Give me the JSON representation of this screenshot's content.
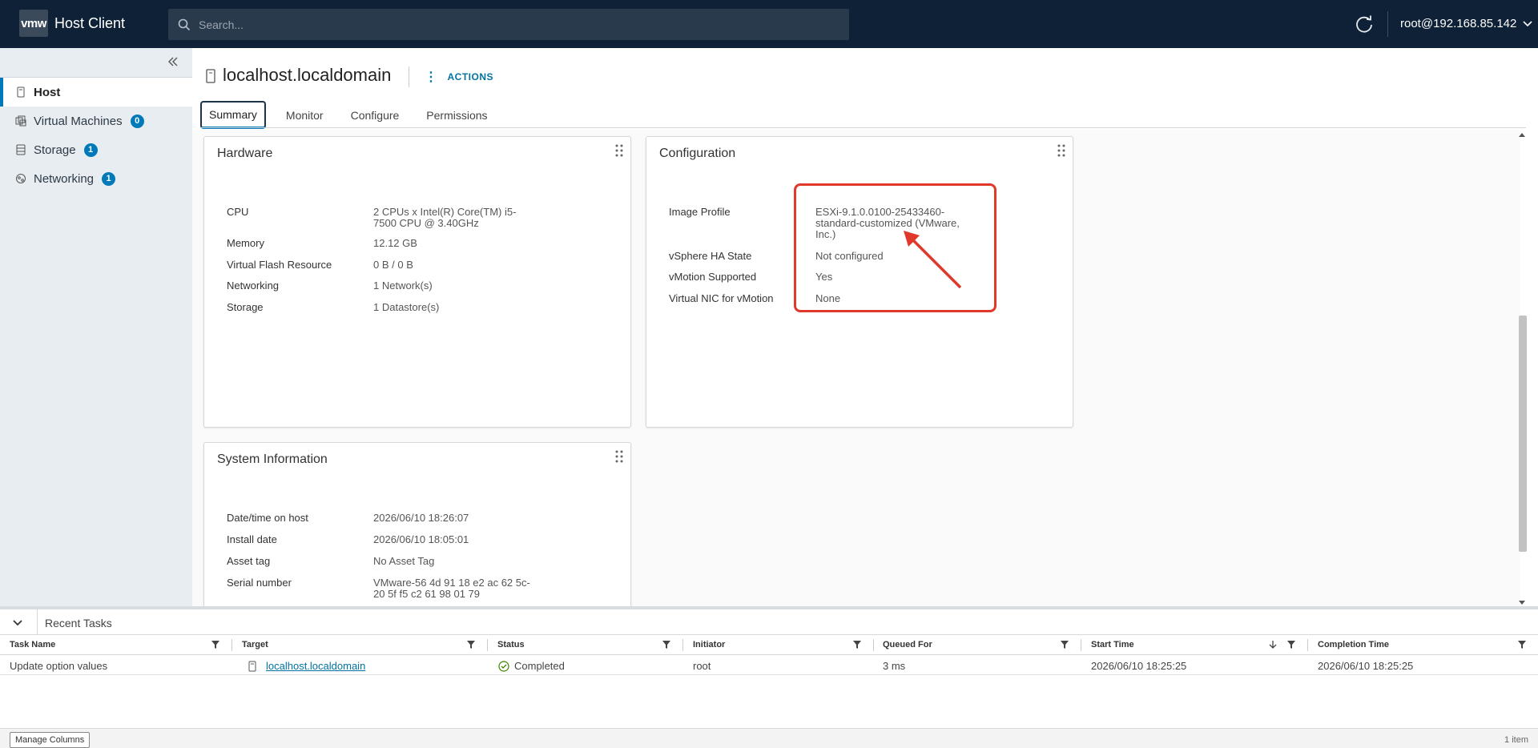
{
  "header": {
    "logo_text": "vmw",
    "app_title": "Host Client",
    "search_placeholder": "Search...",
    "user": "root@192.168.85.142"
  },
  "sidebar": {
    "items": [
      {
        "label": "Host",
        "icon": "host-icon",
        "badge": ""
      },
      {
        "label": "Virtual Machines",
        "icon": "vm-icon",
        "badge": "0"
      },
      {
        "label": "Storage",
        "icon": "storage-icon",
        "badge": "1"
      },
      {
        "label": "Networking",
        "icon": "network-icon",
        "badge": "1"
      }
    ]
  },
  "main": {
    "title": "localhost.localdomain",
    "actions_label": "ACTIONS",
    "tabs": [
      "Summary",
      "Monitor",
      "Configure",
      "Permissions"
    ],
    "active_tab": "Summary"
  },
  "hardware": {
    "title": "Hardware",
    "rows": [
      {
        "k": "CPU",
        "v": "2 CPUs x Intel(R) Core(TM) i5-7500 CPU @ 3.40GHz"
      },
      {
        "k": "Memory",
        "v": "12.12 GB"
      },
      {
        "k": "Virtual Flash Resource",
        "v": "0 B / 0 B"
      },
      {
        "k": "Networking",
        "v": "1 Network(s)"
      },
      {
        "k": "Storage",
        "v": "1 Datastore(s)"
      }
    ]
  },
  "configuration": {
    "title": "Configuration",
    "rows": [
      {
        "k": "Image Profile",
        "v": "ESXi-9.1.0.0100-25433460-standard-customized (VMware, Inc.)"
      },
      {
        "k": "vSphere HA State",
        "v": "Not configured"
      },
      {
        "k": "vMotion Supported",
        "v": "Yes"
      },
      {
        "k": "Virtual NIC for vMotion",
        "v": "None"
      }
    ]
  },
  "system_info": {
    "title": "System Information",
    "rows": [
      {
        "k": "Date/time on host",
        "v": "2026/06/10 18:26:07"
      },
      {
        "k": "Install date",
        "v": "2026/06/10 18:05:01"
      },
      {
        "k": "Asset tag",
        "v": "No Asset Tag"
      },
      {
        "k": "Serial number",
        "v": "VMware-56 4d 91 18 e2 ac 62 5c-20 5f f5 c2 61 98 01 79"
      }
    ]
  },
  "recent_tasks": {
    "title": "Recent Tasks",
    "columns": [
      "Task Name",
      "Target",
      "Status",
      "Initiator",
      "Queued For",
      "Start Time",
      "Completion Time"
    ],
    "rows": [
      {
        "task_name": "Update option values",
        "target": "localhost.localdomain",
        "status": "Completed",
        "initiator": "root",
        "queued_for": "3 ms",
        "start_time": "2026/06/10 18:25:25",
        "completion_time": "2026/06/10 18:25:25"
      }
    ],
    "manage_columns": "Manage Columns",
    "item_count": "1 item"
  },
  "colors": {
    "header_bg": "#0f2137",
    "accent": "#0079b8",
    "highlight_red": "#e0392b",
    "success_green": "#3c8500"
  }
}
